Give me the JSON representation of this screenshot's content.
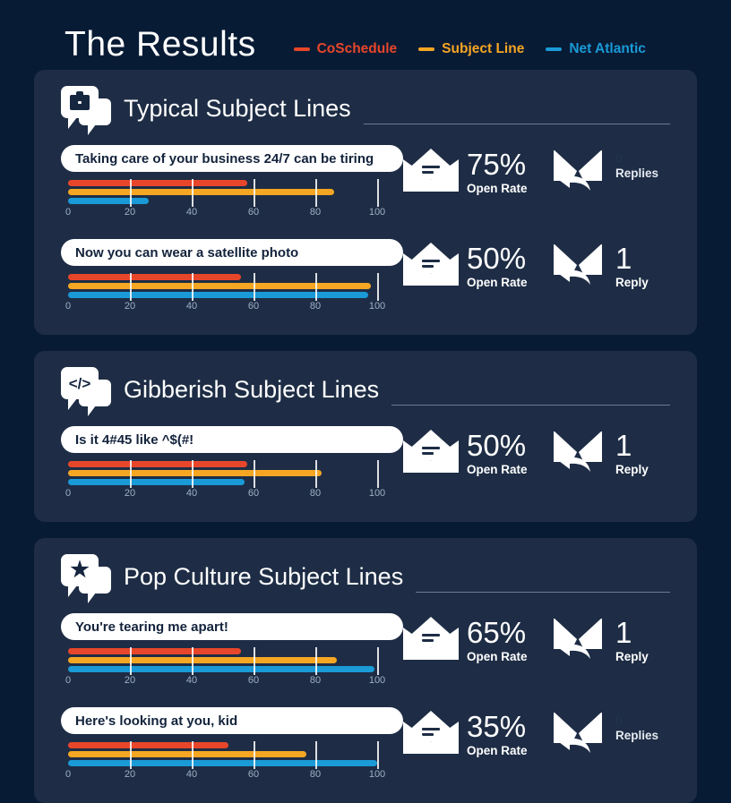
{
  "header": {
    "title": "The Results",
    "legend": [
      {
        "label": "CoSchedule",
        "color": "#e8462a"
      },
      {
        "label": "Subject Line",
        "color": "#f5a623"
      },
      {
        "label": "Net Atlantic",
        "color": "#1a9ad7"
      }
    ]
  },
  "colors": {
    "background": "#081b35",
    "card": "#1e2d45",
    "coschedule": "#e8462a",
    "subject_line": "#f5a623",
    "net_atlantic": "#1a9ad7"
  },
  "chart_data": {
    "type": "bar",
    "title": "The Results",
    "xlabel": "",
    "ylabel": "",
    "xlim": [
      0,
      100
    ],
    "tick_labels": [
      "0",
      "20",
      "40",
      "60",
      "80",
      "100"
    ],
    "grid": true,
    "legend_position": "top",
    "series_names": [
      "CoSchedule",
      "Subject Line",
      "Net Atlantic"
    ],
    "groups": [
      {
        "group": "Typical Subject Lines",
        "rows": [
          {
            "category": "Taking care of your business 24/7 can be tiring",
            "values": [
              58,
              86,
              26
            ],
            "open_rate": "75%",
            "replies": "0"
          },
          {
            "category": "Now you can wear a satellite photo",
            "values": [
              56,
              98,
              97
            ],
            "open_rate": "50%",
            "replies": "1"
          }
        ]
      },
      {
        "group": "Gibberish Subject Lines",
        "rows": [
          {
            "category": "Is it 4#45 like ^$(#!",
            "values": [
              58,
              82,
              57
            ],
            "open_rate": "50%",
            "replies": "1"
          }
        ]
      },
      {
        "group": "Pop Culture Subject Lines",
        "rows": [
          {
            "category": "You're tearing me apart!",
            "values": [
              56,
              87,
              99
            ],
            "open_rate": "65%",
            "replies": "1"
          },
          {
            "category": "Here's looking at you, kid",
            "values": [
              52,
              77,
              100
            ],
            "open_rate": "35%",
            "replies": "0"
          }
        ]
      }
    ]
  },
  "cards": [
    {
      "title": "Typical Subject Lines",
      "icon": "briefcase-speech-bubble-icon",
      "rows": [
        {
          "subject": "Taking care of your business 24/7 can be tiring",
          "bars": [
            58,
            86,
            26
          ],
          "axis": [
            "0",
            "20",
            "40",
            "60",
            "80",
            "100"
          ],
          "open_rate": "75%",
          "open_label": "Open Rate",
          "reply_count": "0",
          "reply_label": "Replies"
        },
        {
          "subject": "Now you can wear a satellite photo",
          "bars": [
            56,
            98,
            97
          ],
          "axis": [
            "0",
            "20",
            "40",
            "60",
            "80",
            "100"
          ],
          "open_rate": "50%",
          "open_label": "Open Rate",
          "reply_count": "1",
          "reply_label": "Reply"
        }
      ]
    },
    {
      "title": "Gibberish Subject Lines",
      "icon": "code-speech-bubble-icon",
      "rows": [
        {
          "subject": "Is it 4#45 like ^$(#!",
          "bars": [
            58,
            82,
            57
          ],
          "axis": [
            "0",
            "20",
            "40",
            "60",
            "80",
            "100"
          ],
          "open_rate": "50%",
          "open_label": "Open Rate",
          "reply_count": "1",
          "reply_label": "Reply"
        }
      ]
    },
    {
      "title": "Pop Culture Subject Lines",
      "icon": "star-speech-bubble-icon",
      "rows": [
        {
          "subject": "You're tearing me apart!",
          "bars": [
            56,
            87,
            99
          ],
          "axis": [
            "0",
            "20",
            "40",
            "60",
            "80",
            "100"
          ],
          "open_rate": "65%",
          "open_label": "Open Rate",
          "reply_count": "1",
          "reply_label": "Reply"
        },
        {
          "subject": "Here's looking at you, kid",
          "bars": [
            52,
            77,
            100
          ],
          "axis": [
            "0",
            "20",
            "40",
            "60",
            "80",
            "100"
          ],
          "open_rate": "35%",
          "open_label": "Open Rate",
          "reply_count": "0",
          "reply_label": "Replies"
        }
      ]
    }
  ]
}
